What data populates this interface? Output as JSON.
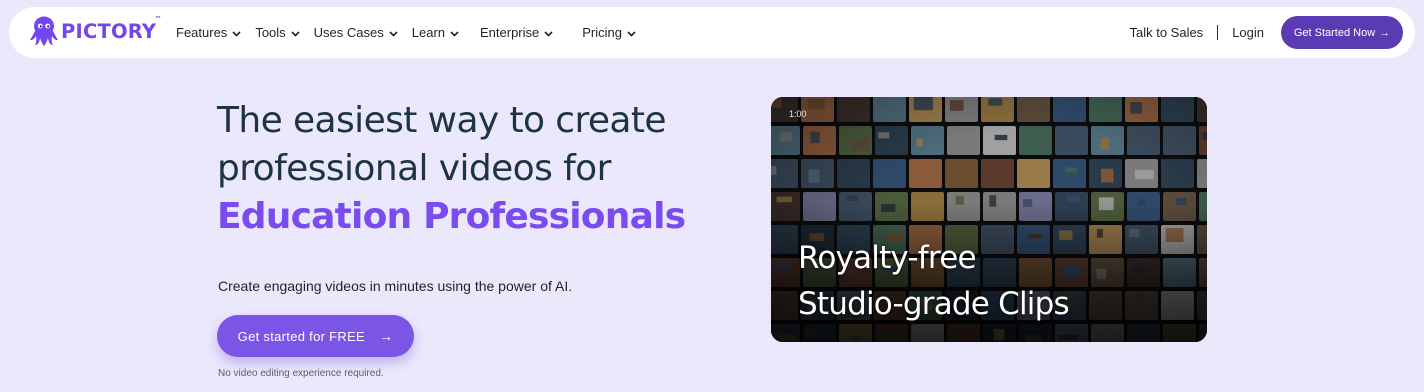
{
  "brand": {
    "name": "PICTORY",
    "trademark": "™",
    "color": "#7247f0"
  },
  "nav": {
    "items": [
      {
        "label": "Features",
        "icon": "chevron-down-icon"
      },
      {
        "label": "Tools",
        "icon": "chevron-down-icon"
      },
      {
        "label": "Uses Cases",
        "icon": "chevron-down-icon"
      },
      {
        "label": "Learn",
        "icon": "chevron-down-icon"
      },
      {
        "label": "Enterprise",
        "icon": "chevron-down-icon"
      },
      {
        "label": "Pricing",
        "icon": "chevron-down-icon"
      }
    ],
    "talk_to_sales": "Talk to Sales",
    "separator": "|",
    "login": "Login",
    "cta_label": "Get Started Now",
    "cta_arrow": "→",
    "cta_color": "#5a3bb4"
  },
  "hero": {
    "title_line1": "The easiest way to create",
    "title_line2": "professional videos for",
    "title_highlight": "Education Professionals",
    "subtitle": "Create engaging videos in minutes using the power of AI.",
    "cta_label": "Get started for FREE",
    "cta_arrow": "→",
    "note": "No video editing experience required.",
    "accent_color": "#7a4cf0",
    "background": "#ebe8fc"
  },
  "media": {
    "overlay_line1": "Royalty-free",
    "overlay_line2": "Studio-grade Clips",
    "timestamp": "1:00"
  }
}
